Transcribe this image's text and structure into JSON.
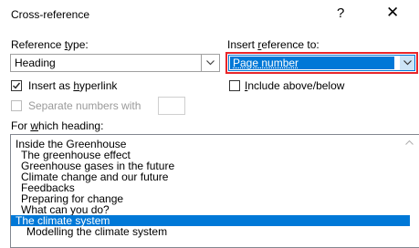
{
  "window": {
    "title": "Cross-reference",
    "help_label": "?",
    "close_label": "✕"
  },
  "reference_type": {
    "label_pre": "Reference ",
    "label_key": "t",
    "label_post": "ype:",
    "value": "Heading"
  },
  "insert_reference": {
    "label_pre": "Insert ",
    "label_key": "r",
    "label_post": "eference to:",
    "value": "Page number"
  },
  "hyperlink": {
    "label_pre": "Insert as ",
    "label_key": "h",
    "label_post": "yperlink",
    "checked": true
  },
  "include_above_below": {
    "label_key": "I",
    "label_post": "nclude above/below",
    "checked": false
  },
  "separate_numbers": {
    "label": "Separate numbers with",
    "checked": false,
    "value": ""
  },
  "which_heading": {
    "label_pre": "For ",
    "label_key": "w",
    "label_post": "hich heading:"
  },
  "headings": [
    {
      "text": "Inside the Greenhouse",
      "level": 1,
      "selected": false
    },
    {
      "text": "The greenhouse effect",
      "level": 2,
      "selected": false
    },
    {
      "text": "Greenhouse gases in the future",
      "level": 2,
      "selected": false
    },
    {
      "text": "Climate change and our future",
      "level": 2,
      "selected": false
    },
    {
      "text": "Feedbacks",
      "level": 2,
      "selected": false
    },
    {
      "text": "Preparing for change",
      "level": 2,
      "selected": false
    },
    {
      "text": "What can you do?",
      "level": 2,
      "selected": false
    },
    {
      "text": "The climate system",
      "level": 1,
      "selected": true
    },
    {
      "text": "Modelling the climate system",
      "level": 2,
      "selected": false
    }
  ],
  "colors": {
    "selection": "#0078d7",
    "focus_outline": "#e8262a"
  },
  "icons": {
    "dropdown": "chevron-down-icon",
    "check": "check-icon",
    "scroll_up": "scroll-up-icon"
  }
}
